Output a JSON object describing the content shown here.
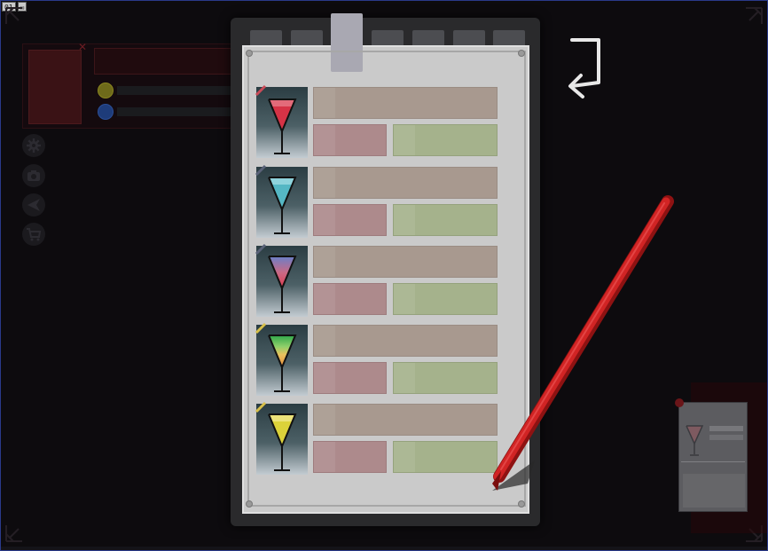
{
  "window": {
    "badge_number": "01",
    "badge_icon": "window-icon"
  },
  "colors": {
    "background": "#0d0b0e",
    "paper": "#cacaca",
    "name_bar": "#a8998f",
    "red_bar": "#ad8a8c",
    "green_bar": "#a5b28c",
    "pen": "#c81e1e",
    "tab_active": "#a9a8b2"
  },
  "left_panel": {
    "stat_icons": [
      "gold-coin-icon",
      "blue-orb-icon"
    ]
  },
  "side_menu": {
    "items": [
      "settings-icon",
      "camera-icon",
      "share-icon",
      "cart-icon"
    ]
  },
  "clipboard": {
    "tab_count": 7,
    "active_tab_index": 2
  },
  "recipes": [
    {
      "drink": "red-cocktail-icon",
      "tag": "red"
    },
    {
      "drink": "cyan-cocktail-icon",
      "tag": "blue"
    },
    {
      "drink": "gradient-cocktail-icon",
      "tag": "blue"
    },
    {
      "drink": "layered-green-cocktail-icon",
      "tag": "yellow"
    },
    {
      "drink": "yellow-cocktail-icon",
      "tag": "yellow"
    }
  ],
  "controls": {
    "back_icon": "return-arrow-icon",
    "pen_icon": "red-pen-icon"
  }
}
